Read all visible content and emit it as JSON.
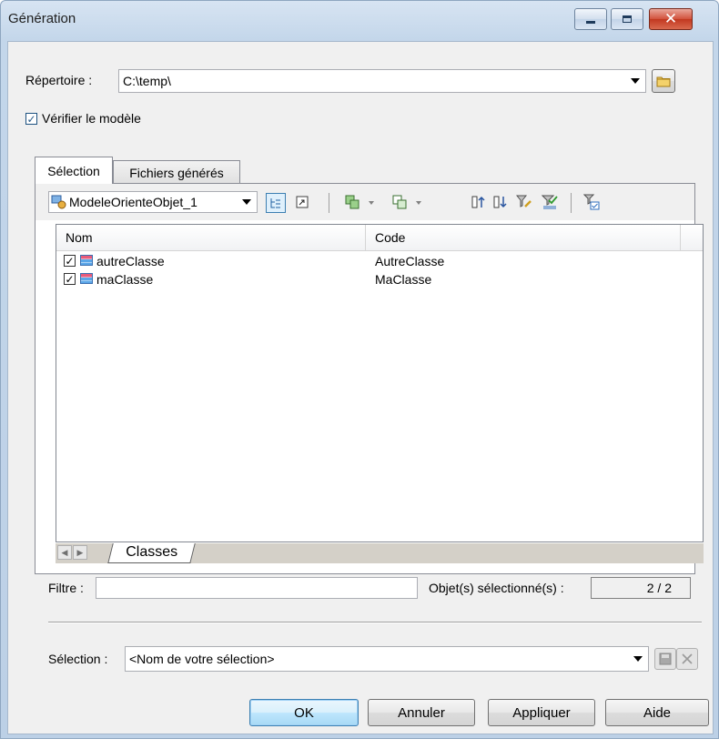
{
  "window": {
    "title": "Génération"
  },
  "title_buttons": {
    "close": "✕"
  },
  "directory": {
    "label": "Répertoire :",
    "value": "C:\\temp\\"
  },
  "check_model": {
    "label": "Vérifier le modèle",
    "checked": true
  },
  "tabs": [
    {
      "label": "Sélection",
      "active": true
    },
    {
      "label": "Fichiers générés",
      "active": false
    }
  ],
  "toolbar": {
    "model_selector": "ModeleOrienteObjet_1",
    "icons": [
      "tree-view-icon",
      "new-window-icon",
      "select-all-icon",
      "deselect-all-icon",
      "move-up-icon",
      "move-down-icon",
      "filter-edit-icon",
      "filter-apply-icon",
      "filter-check-icon"
    ]
  },
  "grid": {
    "columns": [
      "Nom",
      "Code"
    ],
    "rows": [
      {
        "checked": true,
        "name": "autreClasse",
        "code": "AutreClasse"
      },
      {
        "checked": true,
        "name": "maClasse",
        "code": "MaClasse"
      }
    ]
  },
  "sheet_tab": "Classes",
  "filter": {
    "label": "Filtre :",
    "value": ""
  },
  "selected_count": {
    "label": "Objet(s) sélectionné(s) :",
    "value": "2 / 2"
  },
  "selection": {
    "label": "Sélection :",
    "value": "<Nom de votre sélection>"
  },
  "buttons": {
    "ok": "OK",
    "cancel": "Annuler",
    "apply": "Appliquer",
    "help": "Aide"
  },
  "colors": {
    "title_gradient": "#c3d6ea",
    "dialog_bg": "#f0f0f0",
    "default_button": "#3c7fb1"
  }
}
